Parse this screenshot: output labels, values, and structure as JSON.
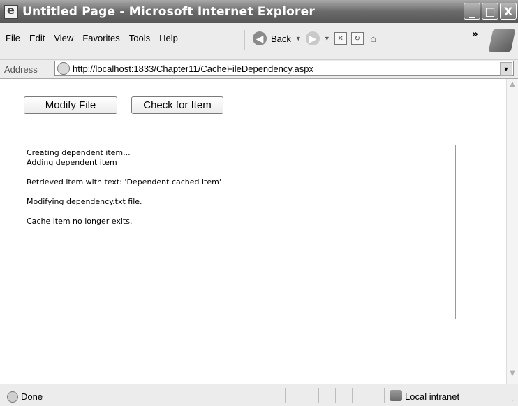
{
  "window": {
    "title": "Untitled Page - Microsoft Internet Explorer",
    "min_label": "_",
    "max_label": "□",
    "close_label": "X"
  },
  "menu": {
    "file": "File",
    "edit": "Edit",
    "view": "View",
    "favorites": "Favorites",
    "tools": "Tools",
    "help": "Help"
  },
  "toolbar": {
    "back_label": "Back",
    "more": "»"
  },
  "address": {
    "label": "Address",
    "url": "http://localhost:1833/Chapter11/CacheFileDependency.aspx"
  },
  "page": {
    "modify_button": "Modify File",
    "check_button": "Check for Item",
    "log_text": "Creating dependent item...\nAdding dependent item\n\nRetrieved item with text: 'Dependent cached item'\n\nModifying dependency.txt file.\n\nCache item no longer exits."
  },
  "status": {
    "text": "Done",
    "zone": "Local intranet"
  }
}
